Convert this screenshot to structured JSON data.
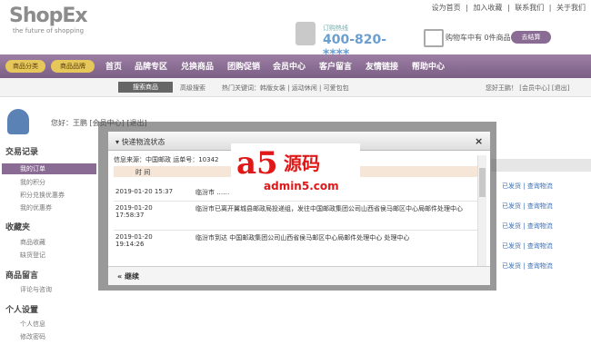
{
  "header": {
    "logo": "ShopEx",
    "tagline": "the future of shopping",
    "top_links": [
      "设为首页",
      "|",
      "加入收藏",
      "|",
      "联系我们",
      "|",
      "关于我们"
    ],
    "hotline_label": "订购热线",
    "hotline_number": "400-820-****",
    "cart_text": "购物车中有 0件商品",
    "checkout": "去结算"
  },
  "nav": {
    "pills": [
      "商品分类",
      "商品品牌"
    ],
    "items": [
      "首页",
      "品牌专区",
      "兑换商品",
      "团购促销",
      "会员中心",
      "客户留言",
      "友情链接",
      "帮助中心"
    ]
  },
  "subnav": {
    "search_button": "搜索商品",
    "advanced": "高级搜索",
    "hot_keywords": "热门关键词：韩版女装 | 运动休闲 | 可爱包包",
    "right": "您好王鹏！ [会员中心] [退出]"
  },
  "user": {
    "greeting": "您好：王鹏 [会员中心] [退出]"
  },
  "sidebar": {
    "sections": [
      {
        "title": "交易记录",
        "items": [
          "我的订单",
          "我的积分",
          "积分兑换优惠券",
          "我的优惠券"
        ]
      },
      {
        "title": "收藏夹",
        "items": [
          "商品收藏",
          "缺货登记"
        ]
      },
      {
        "title": "商品留言",
        "items": [
          "评论与咨询"
        ]
      },
      {
        "title": "个人设置",
        "items": [
          "个人信息",
          "修改密码"
        ]
      }
    ]
  },
  "background_rows": [
    {
      "status": "已发货",
      "link": "查询物流"
    },
    {
      "status": "已发货",
      "link": "查询物流"
    },
    {
      "status": "已发货",
      "link": "查询物流"
    },
    {
      "status": "已发货",
      "link": "查询物流"
    },
    {
      "status": "已发货",
      "link": "查询物流"
    }
  ],
  "modal": {
    "title": "快递物流状态",
    "close": "×",
    "info": "信息来源：中国邮政 运单号：10342",
    "col_time": "时  间",
    "rows": [
      {
        "time": "2019-01-20 15:37",
        "desc": "临汾市 ……  姓名：段红线,联系电话:)"
      },
      {
        "time": "2019-01-20 17:58:37",
        "desc": "临汾市已离开翼城县邮政局投递组，发往中国邮政集团公司山西省侯马邮区中心局邮件处理中心"
      },
      {
        "time": "2019-01-20 19:14:26",
        "desc": "临汾市到达 中国邮政集团公司山西省侯马邮区中心局邮件处理中心 处理中心"
      }
    ],
    "continue": "« 继续"
  },
  "watermark": {
    "a": "a5",
    "han": "源码",
    "url": "admin5.com"
  }
}
